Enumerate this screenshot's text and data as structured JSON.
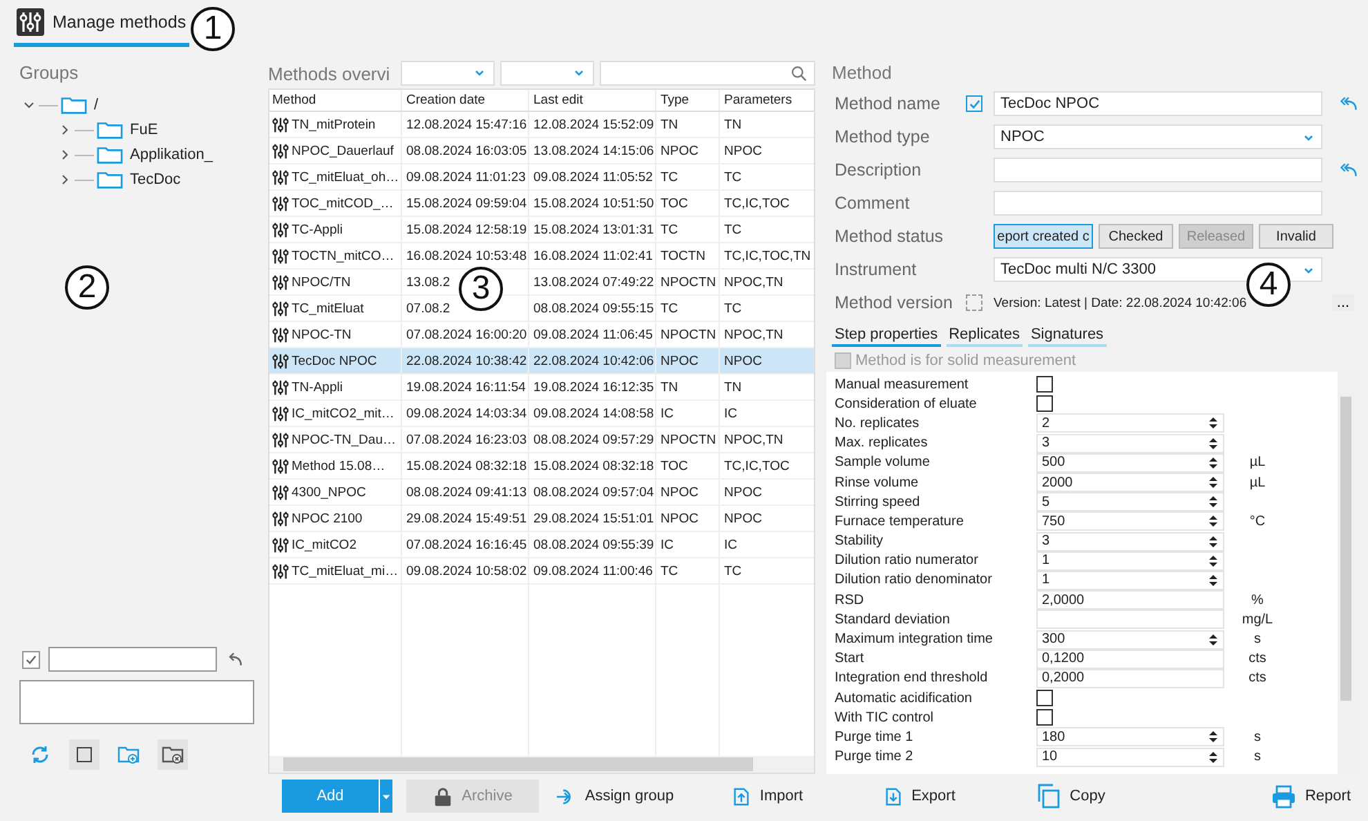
{
  "tab": {
    "label": "Manage methods",
    "selected": true
  },
  "groups": {
    "title": "Groups",
    "tree": [
      {
        "label": "/",
        "expanded": true,
        "children": [
          {
            "label": "FuE",
            "expanded": false
          },
          {
            "label": "Applikation_",
            "expanded": false
          },
          {
            "label": "TecDoc",
            "expanded": false
          }
        ]
      }
    ],
    "filter_checked": true
  },
  "overview": {
    "title": "Methods overvi",
    "columns": [
      "Method",
      "Creation date",
      "Last edit",
      "Type",
      "Parameters"
    ],
    "rows": [
      {
        "cells": [
          "TN_mitProtein",
          "12.08.2024 15:47:16",
          "12.08.2024 15:52:09",
          "TN",
          "TN"
        ],
        "selected": false
      },
      {
        "cells": [
          "NPOC_Dauerlauf",
          "08.08.2024 16:03:05",
          "13.08.2024 14:15:06",
          "NPOC",
          "NPOC"
        ],
        "selected": false
      },
      {
        "cells": [
          "TC_mitEluat_oh…",
          "09.08.2024 11:01:23",
          "09.08.2024 11:05:52",
          "TC",
          "TC"
        ],
        "selected": false
      },
      {
        "cells": [
          "TOC_mitCOD_…",
          "15.08.2024 09:59:04",
          "15.08.2024 10:51:50",
          "TOC",
          "TC,IC,TOC"
        ],
        "selected": false
      },
      {
        "cells": [
          "TC-Appli",
          "15.08.2024 12:58:19",
          "15.08.2024 13:01:31",
          "TC",
          "TC"
        ],
        "selected": false
      },
      {
        "cells": [
          "TOCTN_mitCO…",
          "16.08.2024 10:53:48",
          "16.08.2024 11:02:41",
          "TOCTN",
          "TC,IC,TOC,TN"
        ],
        "selected": false
      },
      {
        "cells": [
          "NPOC/TN",
          "13.08.2",
          "13.08.2024 07:49:22",
          "NPOCTN",
          "NPOC,TN"
        ],
        "selected": false
      },
      {
        "cells": [
          "TC_mitEluat",
          "07.08.2",
          "08.08.2024 09:55:15",
          "TC",
          "TC"
        ],
        "selected": false
      },
      {
        "cells": [
          "NPOC-TN",
          "07.08.2024 16:00:20",
          "09.08.2024 11:06:45",
          "NPOCTN",
          "NPOC,TN"
        ],
        "selected": false
      },
      {
        "cells": [
          "TecDoc NPOC",
          "22.08.2024 10:38:42",
          "22.08.2024 10:42:06",
          "NPOC",
          "NPOC"
        ],
        "selected": true
      },
      {
        "cells": [
          "TN-Appli",
          "19.08.2024 16:11:54",
          "19.08.2024 16:12:35",
          "TN",
          "TN"
        ],
        "selected": false
      },
      {
        "cells": [
          "IC_mitCO2_mit…",
          "09.08.2024 14:03:34",
          "09.08.2024 14:08:58",
          "IC",
          "IC"
        ],
        "selected": false
      },
      {
        "cells": [
          "NPOC-TN_Dau…",
          "07.08.2024 16:23:03",
          "08.08.2024 09:57:29",
          "NPOCTN",
          "NPOC,TN"
        ],
        "selected": false
      },
      {
        "cells": [
          "Method 15.08…",
          "15.08.2024 08:32:18",
          "15.08.2024 08:32:18",
          "TOC",
          "TC,IC,TOC"
        ],
        "selected": false
      },
      {
        "cells": [
          "4300_NPOC",
          "08.08.2024 09:41:13",
          "08.08.2024 09:57:04",
          "NPOC",
          "NPOC"
        ],
        "selected": false
      },
      {
        "cells": [
          "NPOC 2100",
          "29.08.2024 15:49:51",
          "29.08.2024 15:51:01",
          "NPOC",
          "NPOC"
        ],
        "selected": false
      },
      {
        "cells": [
          "IC_mitCO2",
          "07.08.2024 16:16:45",
          "08.08.2024 09:55:39",
          "IC",
          "IC"
        ],
        "selected": false
      },
      {
        "cells": [
          "TC_mitEluat_mi…",
          "09.08.2024 10:58:02",
          "09.08.2024 11:00:46",
          "TC",
          "TC"
        ],
        "selected": false
      }
    ]
  },
  "method": {
    "title": "Method",
    "name_label": "Method name",
    "name_checked": true,
    "name": "TecDoc NPOC",
    "type_label": "Method type",
    "type": "NPOC",
    "description_label": "Description",
    "comment_label": "Comment",
    "status_label": "Method status",
    "statuses": [
      {
        "label": "eport created c",
        "selected": true,
        "disabled": false
      },
      {
        "label": "Checked",
        "selected": false,
        "disabled": false
      },
      {
        "label": "Released",
        "selected": false,
        "disabled": true
      },
      {
        "label": "Invalid",
        "selected": false,
        "disabled": false
      }
    ],
    "instrument_label": "Instrument",
    "instrument": "TecDoc multi N/C 3300",
    "version_label": "Method version",
    "version_checked": false,
    "version": "Version: Latest | Date: 22.08.2024 10:42:06",
    "more": "...",
    "tabs": [
      {
        "label": "Step properties",
        "selected": true
      },
      {
        "label": "Replicates",
        "selected": false
      },
      {
        "label": "Signatures",
        "selected": false
      }
    ],
    "solid": {
      "label": "Method is for solid measurement",
      "checked": false,
      "disabled": true
    },
    "properties": [
      {
        "label": "Manual measurement",
        "kind": "checkbox",
        "checked": false
      },
      {
        "label": "Consideration of eluate",
        "kind": "checkbox",
        "checked": false
      },
      {
        "label": "No. replicates",
        "kind": "spin",
        "value": "2"
      },
      {
        "label": "Max. replicates",
        "kind": "spin",
        "value": "3"
      },
      {
        "label": "Sample volume",
        "kind": "spin",
        "value": "500",
        "unit": "µL"
      },
      {
        "label": "Rinse volume",
        "kind": "spin",
        "value": "2000",
        "unit": "µL"
      },
      {
        "label": "Stirring speed",
        "kind": "spin",
        "value": "5"
      },
      {
        "label": "Furnace temperature",
        "kind": "spin",
        "value": "750",
        "unit": "°C"
      },
      {
        "label": "Stability",
        "kind": "spin",
        "value": "3"
      },
      {
        "label": "Dilution ratio numerator",
        "kind": "spin",
        "value": "1"
      },
      {
        "label": "Dilution ratio denominator",
        "kind": "spin",
        "value": "1"
      },
      {
        "label": "RSD",
        "kind": "text",
        "value": "2,0000",
        "unit": "%"
      },
      {
        "label": "Standard deviation",
        "kind": "text",
        "unit": "mg/L"
      },
      {
        "label": "Maximum integration time",
        "kind": "spin",
        "value": "300",
        "unit": "s"
      },
      {
        "label": "Start",
        "kind": "text",
        "value": "0,1200",
        "unit": "cts"
      },
      {
        "label": "Integration end threshold",
        "kind": "text",
        "value": "0,2000",
        "unit": "cts"
      },
      {
        "label": "Automatic acidification",
        "kind": "checkbox",
        "checked": false
      },
      {
        "label": "With TIC control",
        "kind": "checkbox",
        "checked": false
      },
      {
        "label": "Purge time 1",
        "kind": "spin",
        "value": "180",
        "unit": "s"
      },
      {
        "label": "Purge time 2",
        "kind": "spin",
        "value": "10",
        "unit": "s"
      }
    ]
  },
  "actions": [
    {
      "label": "Add",
      "kind": "primary",
      "disabled": false
    },
    {
      "label": "Archive",
      "kind": "archive",
      "disabled": true
    },
    {
      "label": "Assign group",
      "kind": "assign",
      "disabled": false
    },
    {
      "label": "Import",
      "kind": "import",
      "disabled": false
    },
    {
      "label": "Export",
      "kind": "export",
      "disabled": false
    },
    {
      "label": "Copy",
      "kind": "copy",
      "disabled": false
    },
    {
      "label": "Report",
      "kind": "report",
      "disabled": false
    }
  ],
  "callouts": [
    "1",
    "2",
    "3",
    "4"
  ]
}
